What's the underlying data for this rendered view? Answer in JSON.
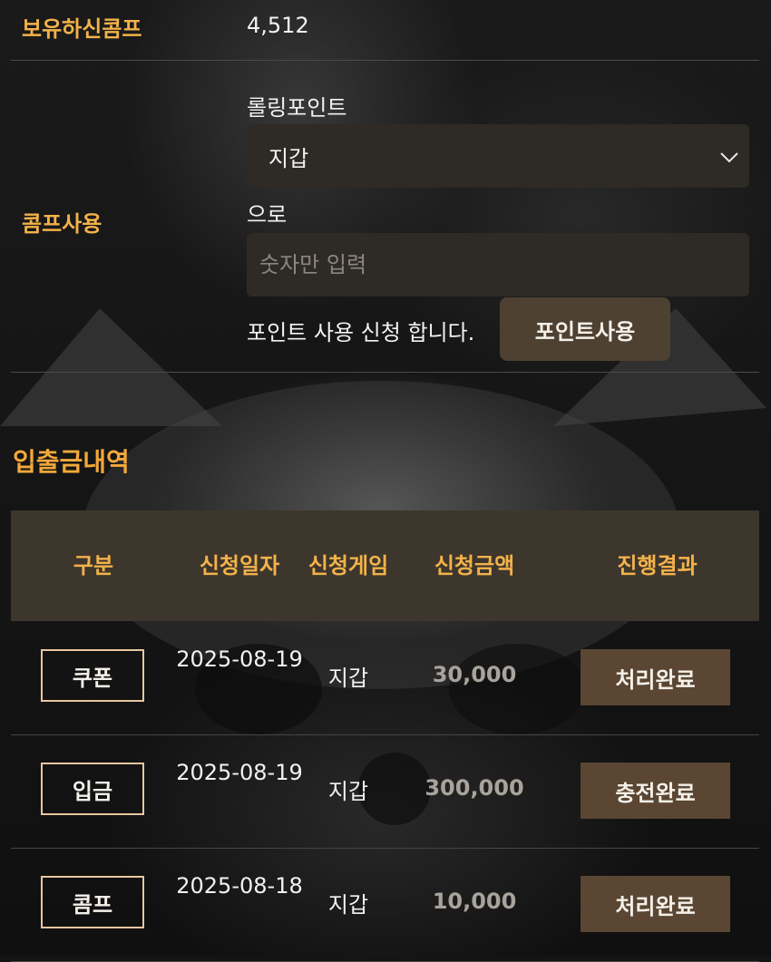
{
  "held_comp": {
    "label": "보유하신콤프",
    "value": "4,512"
  },
  "comp_use": {
    "label": "콤프사용",
    "rolling_label": "롤링포인트",
    "select_value": "지갑",
    "to_label": "으로",
    "amount_placeholder": "숫자만 입력",
    "apply_text": "포인트 사용 신청 합니다.",
    "submit_label": "포인트사용"
  },
  "history": {
    "title": "입출금내역",
    "columns": [
      "구분",
      "신청일자",
      "신청게임",
      "신청금액",
      "진행결과"
    ],
    "rows": [
      {
        "type": "쿠폰",
        "date": "2025-08-19",
        "game": "지갑",
        "amount": "30,000",
        "status": "처리완료"
      },
      {
        "type": "입금",
        "date": "2025-08-19",
        "game": "지갑",
        "amount": "300,000",
        "status": "충전완료"
      },
      {
        "type": "콤프",
        "date": "2025-08-18",
        "game": "지갑",
        "amount": "10,000",
        "status": "처리완료"
      }
    ]
  },
  "colors": {
    "accent": "#f3b24a",
    "field_bg": "#2e2a25",
    "header_bg": "#3d362d",
    "badge_bg": "#5a4632",
    "button_bg": "#4e4132"
  },
  "icons": {
    "select_arrow": "chevron-down-icon"
  }
}
